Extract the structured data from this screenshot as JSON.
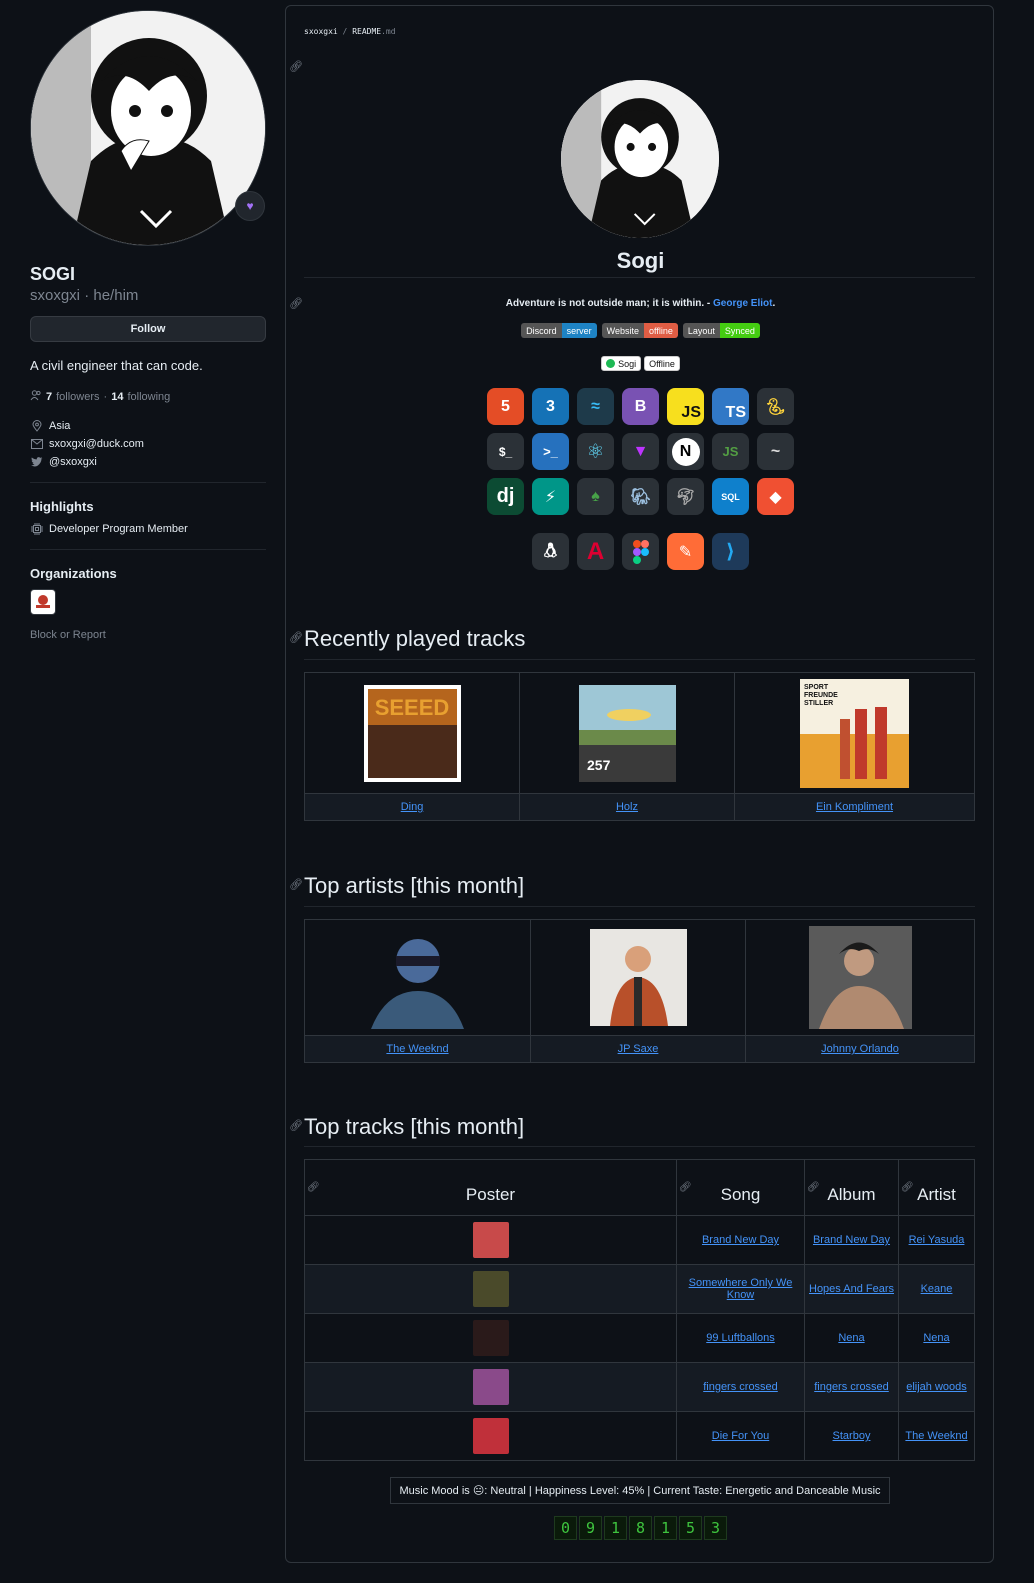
{
  "profile": {
    "name": "SOGI",
    "login": "sxoxgxi",
    "pronouns": "he/him",
    "follow_label": "Follow",
    "bio": "A civil engineer that can code.",
    "followers_count": "7",
    "followers_label": "followers",
    "following_count": "14",
    "following_label": "following",
    "location": "Asia",
    "email": "sxoxgxi@duck.com",
    "twitter": "@sxoxgxi",
    "highlights_title": "Highlights",
    "highlight_item": "Developer Program Member",
    "organizations_title": "Organizations",
    "block_report": "Block or Report"
  },
  "readme": {
    "crumb_user": "sxoxgxi",
    "crumb_file": "README",
    "crumb_ext": ".md",
    "heading": "Sogi",
    "quote": "Adventure is not outside man; it is within. - ",
    "quote_author": "George Eliot",
    "quote_end": ".",
    "badges": [
      {
        "label": "Discord",
        "value": "server",
        "color": "#1e83c4"
      },
      {
        "label": "Website",
        "value": "offline",
        "color": "#e05d44"
      },
      {
        "label": "Layout",
        "value": "Synced",
        "color": "#4c1"
      }
    ],
    "spotify": {
      "name": "Sogi",
      "status": "Offline"
    },
    "tech_icons_row1": [
      "html5-icon",
      "css3-icon",
      "tailwind-icon",
      "bootstrap-icon",
      "javascript-icon",
      "typescript-icon",
      "python-icon"
    ],
    "tech_icons_row2": [
      "bash-icon",
      "powershell-icon",
      "react-icon",
      "vite-icon",
      "nextjs-icon",
      "nodejs-icon",
      "flask-icon"
    ],
    "tech_icons_row3": [
      "django-icon",
      "fastapi-icon",
      "mongodb-icon",
      "postgresql-icon",
      "mysql-icon",
      "sqlite-icon",
      "git-icon"
    ],
    "tool_icons": [
      "linux-icon",
      "angular-icon",
      "figma-icon",
      "postman-icon",
      "vscode-icon"
    ],
    "recent_title": "Recently played tracks",
    "recent_tracks": [
      "Ding",
      "Holz",
      "Ein Kompliment"
    ],
    "artists_title": "Top artists [this month]",
    "artists": [
      "The Weeknd",
      "JP Saxe",
      "Johnny Orlando"
    ],
    "tracks_title": "Top tracks [this month]",
    "tracks_headers": [
      "Poster",
      "Song",
      "Album",
      "Artist"
    ],
    "tracks": [
      {
        "song": "Brand New Day",
        "album": "Brand New Day",
        "artist": "Rei Yasuda",
        "color": "#c84a4a"
      },
      {
        "song": "Somewhere Only We Know",
        "album": "Hopes And Fears",
        "artist": "Keane",
        "color": "#4a4a2a"
      },
      {
        "song": "99 Luftballons",
        "album": "Nena",
        "artist": "Nena",
        "color": "#2a1a1a"
      },
      {
        "song": "fingers crossed",
        "album": "fingers crossed",
        "artist": "elijah woods",
        "color": "#8a4a8a"
      },
      {
        "song": "Die For You",
        "album": "Starboy",
        "artist": "The Weeknd",
        "color": "#c0303a"
      }
    ],
    "mood": "Music Mood is 😐: Neutral | Happiness Level: 45% | Current Taste: Energetic and Danceable Music",
    "counter": [
      "0",
      "9",
      "1",
      "8",
      "1",
      "5",
      "3"
    ]
  }
}
